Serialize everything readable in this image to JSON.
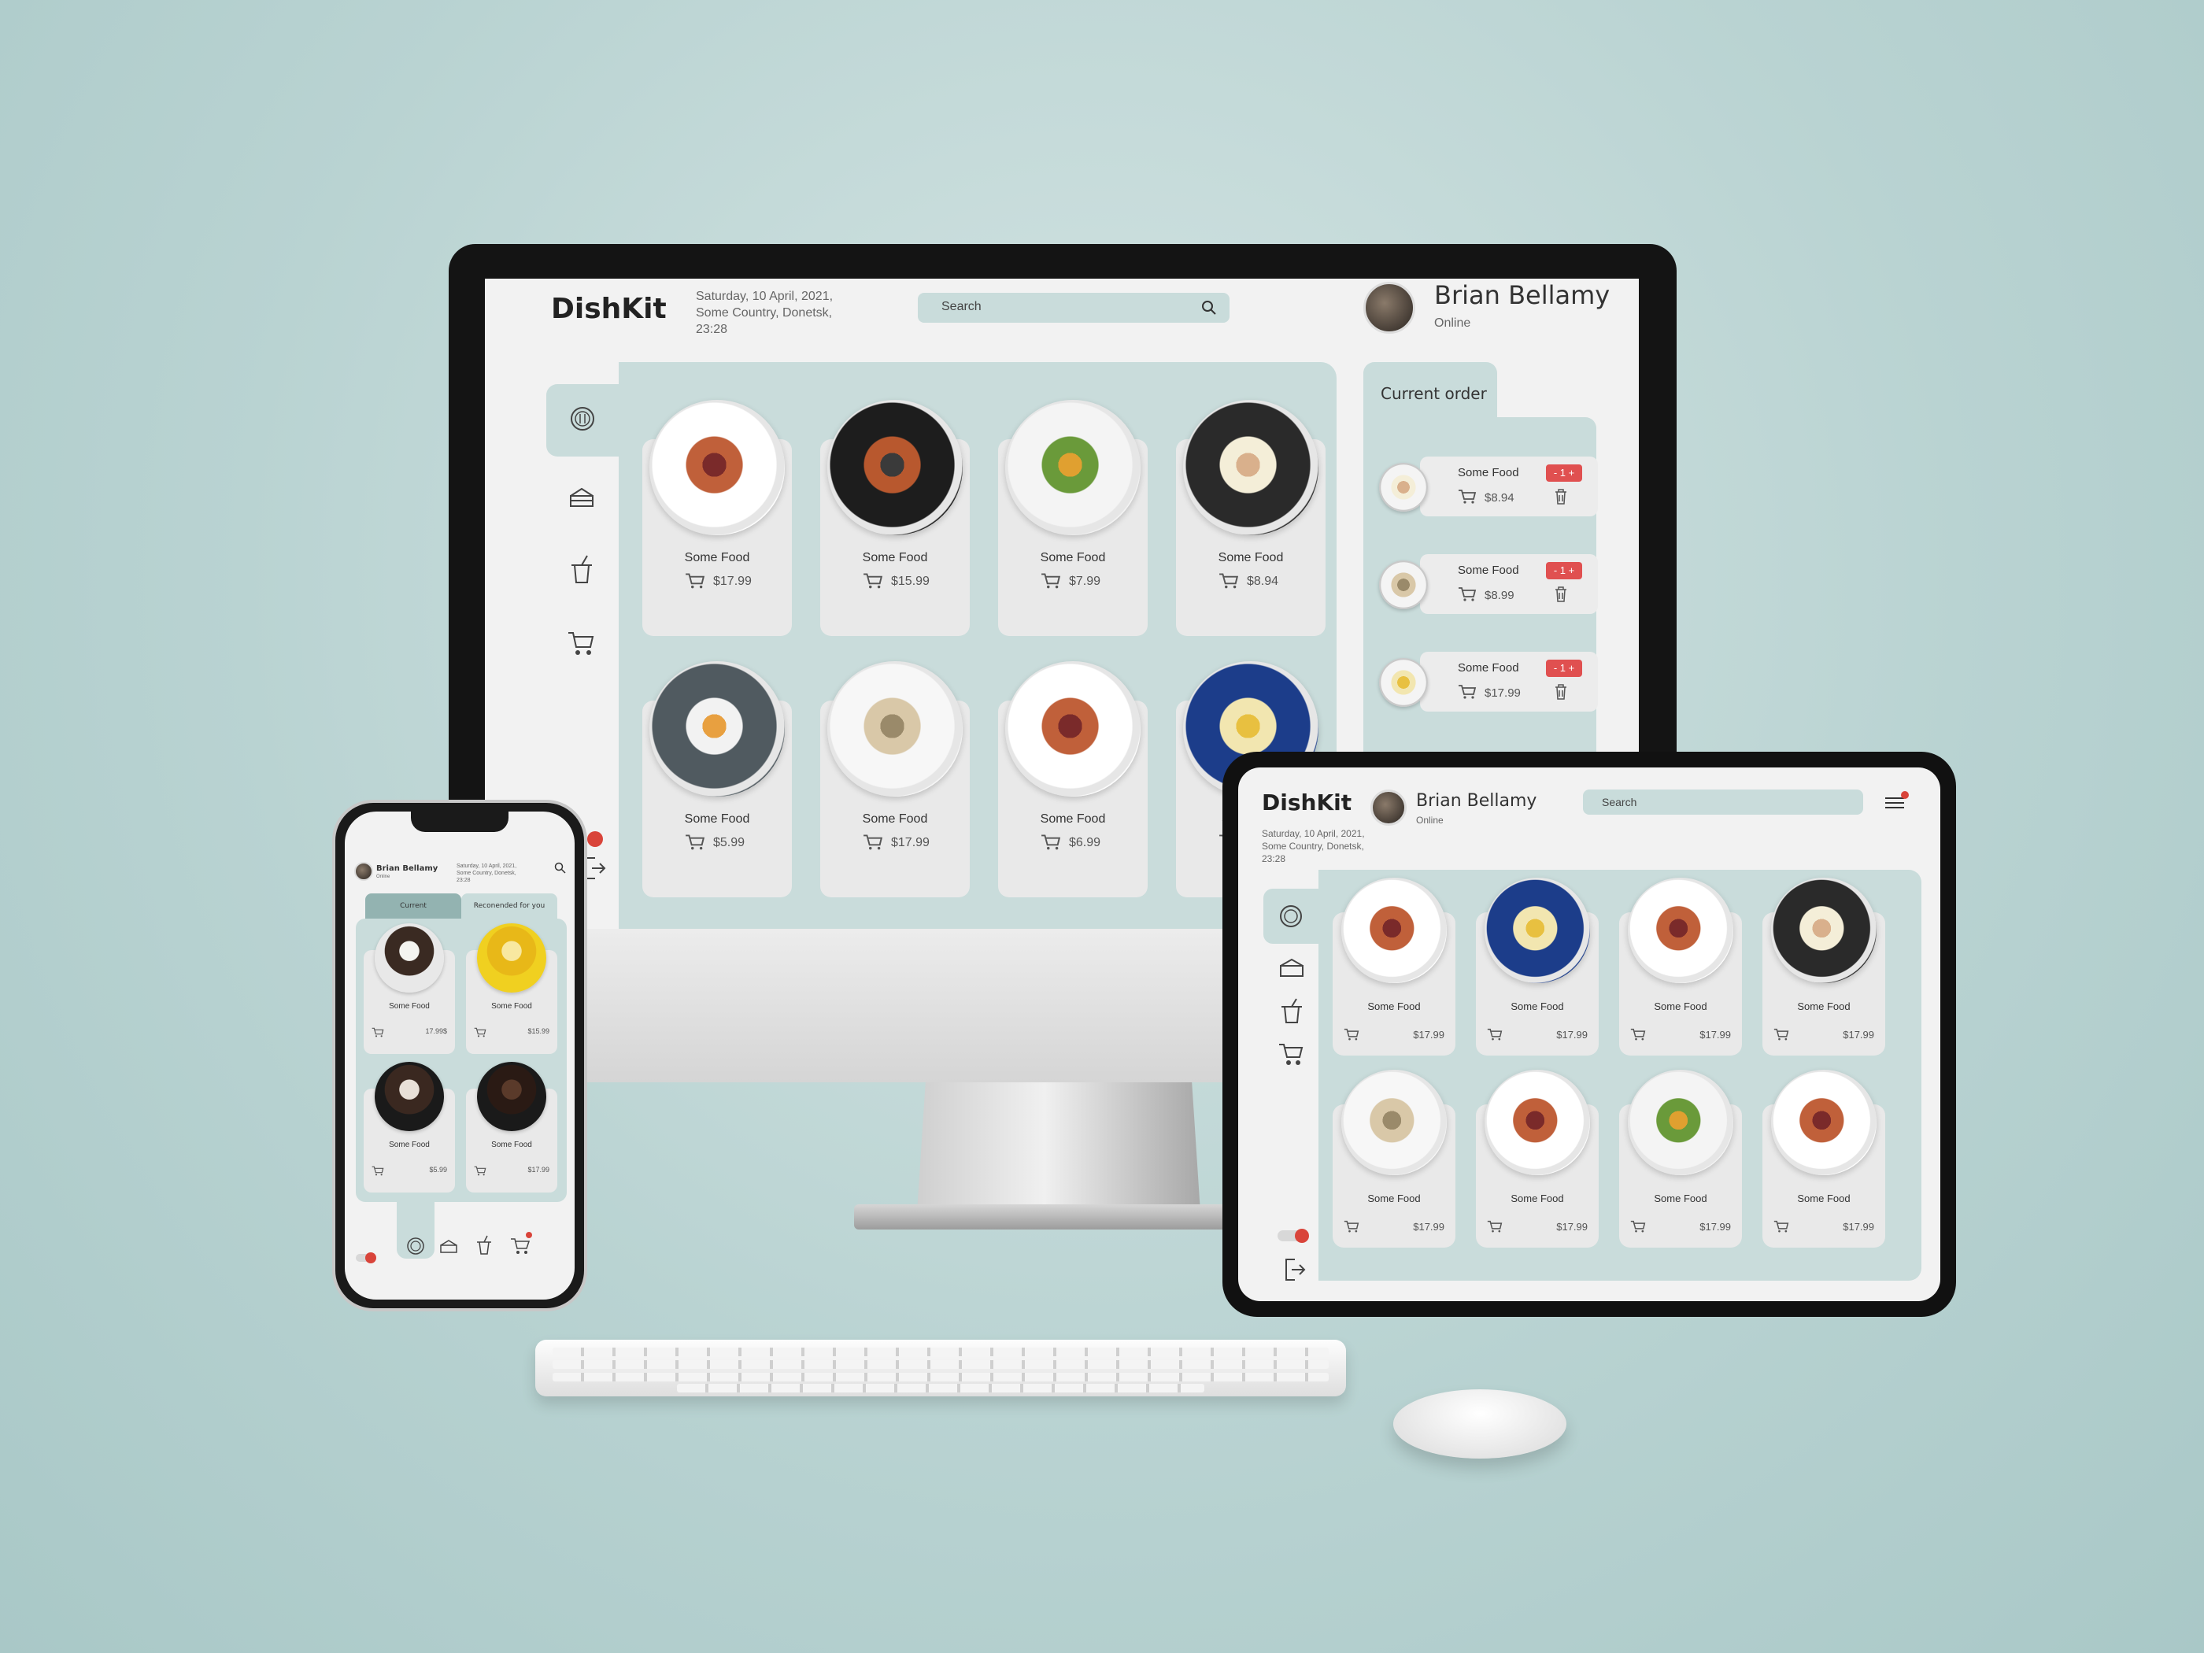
{
  "app": {
    "brand": "DishKit"
  },
  "meta": {
    "date_line1": "Saturday, 10 April, 2021,",
    "date_line2": "Some Country, Donetsk,",
    "time": "23:28"
  },
  "search": {
    "label": "Search"
  },
  "user": {
    "name": "Brian Bellamy",
    "status": "Online"
  },
  "order": {
    "title": "Current order",
    "items": [
      {
        "name": "Some Food",
        "price": "$8.94",
        "qty": "- 1 +"
      },
      {
        "name": "Some Food",
        "price": "$8.99",
        "qty": "- 1 +"
      },
      {
        "name": "Some Food",
        "price": "$17.99",
        "qty": "- 1 +"
      }
    ]
  },
  "desktop_menu": [
    {
      "name": "Some Food",
      "price": "$17.99"
    },
    {
      "name": "Some Food",
      "price": "$15.99"
    },
    {
      "name": "Some Food",
      "price": "$7.99"
    },
    {
      "name": "Some Food",
      "price": "$8.94"
    },
    {
      "name": "Some Food",
      "price": "$5.99"
    },
    {
      "name": "Some Food",
      "price": "$17.99"
    },
    {
      "name": "Some Food",
      "price": "$6.99"
    },
    {
      "name": "So"
    }
  ],
  "tablet_menu": [
    {
      "name": "Some Food",
      "price": "$17.99"
    },
    {
      "name": "Some Food",
      "price": "$17.99"
    },
    {
      "name": "Some Food",
      "price": "$17.99"
    },
    {
      "name": "Some Food",
      "price": "$17.99"
    },
    {
      "name": "Some Food",
      "price": "$17.99"
    },
    {
      "name": "Some Food",
      "price": "$17.99"
    },
    {
      "name": "Some Food",
      "price": "$17.99"
    },
    {
      "name": "Some Food",
      "price": "$17.99"
    }
  ],
  "phone": {
    "tabs": [
      "Current",
      "Reconended for you"
    ],
    "items": [
      {
        "name": "Some Food",
        "price": "17.99$"
      },
      {
        "name": "Some Food",
        "price": "$15.99"
      },
      {
        "name": "Some Food",
        "price": "$5.99"
      },
      {
        "name": "Some Food",
        "price": "$17.99"
      }
    ]
  },
  "icons": {
    "sidebar": [
      "dish-icon",
      "cake-icon",
      "drink-icon",
      "cart-icon"
    ],
    "other": [
      "search-icon",
      "logout-icon",
      "toggle-icon",
      "menu-icon",
      "trash-icon"
    ]
  },
  "colors": {
    "accent": "#c9dcdb",
    "card": "#e9e9e9",
    "badge": "#e05050",
    "dot": "#d9443a",
    "bg": "#b9d3d2"
  }
}
